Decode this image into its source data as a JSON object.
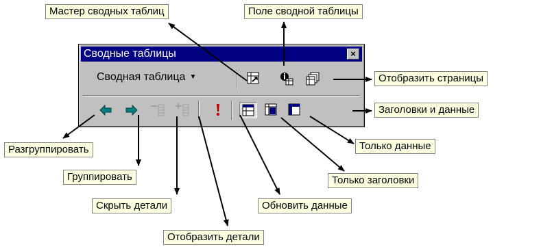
{
  "toolbar": {
    "title": "Сводные таблицы",
    "close_label": "×",
    "menu_label": "Сводная таблица",
    "menu_arrow": "▼"
  },
  "callouts": {
    "wizard": "Мастер сводных таблиц",
    "field": "Поле сводной таблицы",
    "show_pages": "Отобразить страницы",
    "headers_and_data": "Заголовки и данные",
    "data_only": "Только данные",
    "headers_only": "Только заголовки",
    "ungroup": "Разгруппировать",
    "group": "Группировать",
    "hide_details": "Скрыть детали",
    "show_details": "Отобразить детали",
    "refresh": "Обновить данные"
  },
  "icons": {
    "wizard": "pivot-wizard-icon",
    "field": "pivot-field-icon",
    "show_pages": "show-pages-icon",
    "ungroup": "arrow-left-icon",
    "group": "arrow-right-icon",
    "hide_details": "hide-detail-icon",
    "show_details": "show-detail-icon",
    "refresh": "exclamation-refresh-icon",
    "select_headers_and_data": "select-headers-and-data-icon",
    "select_data_only": "select-data-only-icon",
    "select_headers_only": "select-headers-only-icon"
  },
  "colors": {
    "titlebar": "#000080",
    "callout_bg": "#ffffe1",
    "toolbar_bg": "#c0c0c0",
    "arrow_green": "#008080",
    "refresh_red": "#c00000"
  }
}
